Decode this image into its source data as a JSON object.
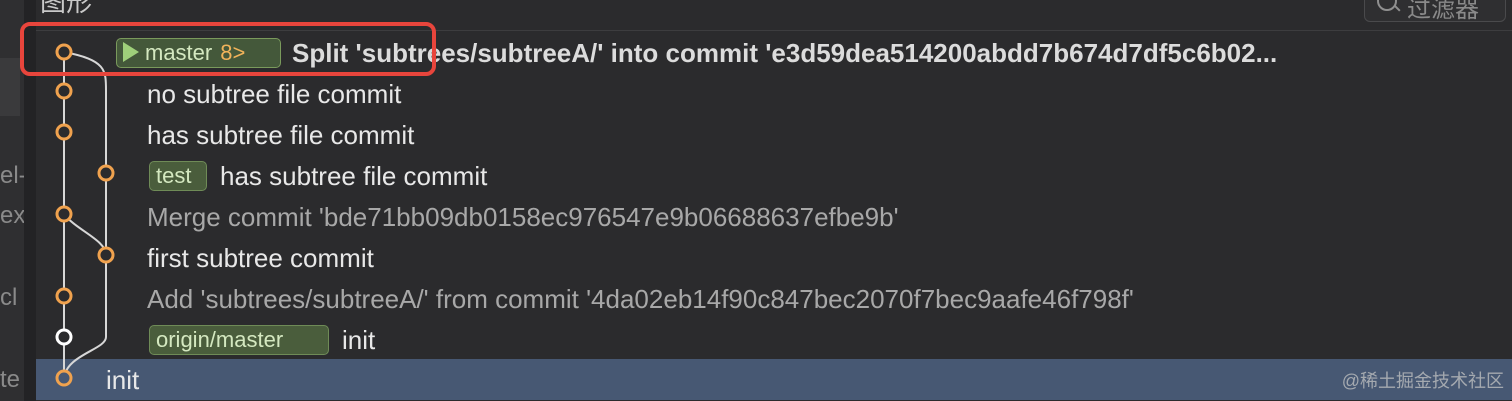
{
  "header": {
    "title": "图形",
    "filter_placeholder": "过滤器"
  },
  "sidebar_fragments": [
    "el-",
    "ex",
    "cl",
    "te"
  ],
  "commits": [
    {
      "message": "Split 'subtrees/subtreeA/' into commit 'e3d59dea514200abdd7b674d7df5c6b02...",
      "refs": [
        {
          "label": "master",
          "count": "8>",
          "is_head": true
        }
      ],
      "style": "bold"
    },
    {
      "message": "no subtree file commit",
      "refs": [],
      "style": "normal"
    },
    {
      "message": "has subtree file commit",
      "refs": [],
      "style": "normal"
    },
    {
      "message": "has subtree file commit",
      "refs": [
        {
          "label": "test"
        }
      ],
      "style": "normal"
    },
    {
      "message": "Merge commit 'bde71bb09db0158ec976547e9b06688637efbe9b'",
      "refs": [],
      "style": "dim"
    },
    {
      "message": "first subtree commit",
      "refs": [],
      "style": "normal"
    },
    {
      "message": "Add 'subtrees/subtreeA/' from commit '4da02eb14f90c847bec2070f7bec9aafe46f798f'",
      "refs": [],
      "style": "dim"
    },
    {
      "message": "init",
      "refs": [
        {
          "label": "origin/master"
        }
      ],
      "style": "normal"
    },
    {
      "message": "init",
      "refs": [],
      "style": "normal",
      "selected": true
    }
  ],
  "colors": {
    "graph_line": "#d7d7d7",
    "node_orange": "#f0a24e",
    "node_white": "#ffffff",
    "selected_row": "#475873",
    "highlight": "#e8453c"
  },
  "watermark": "@稀土掘金技术社区"
}
